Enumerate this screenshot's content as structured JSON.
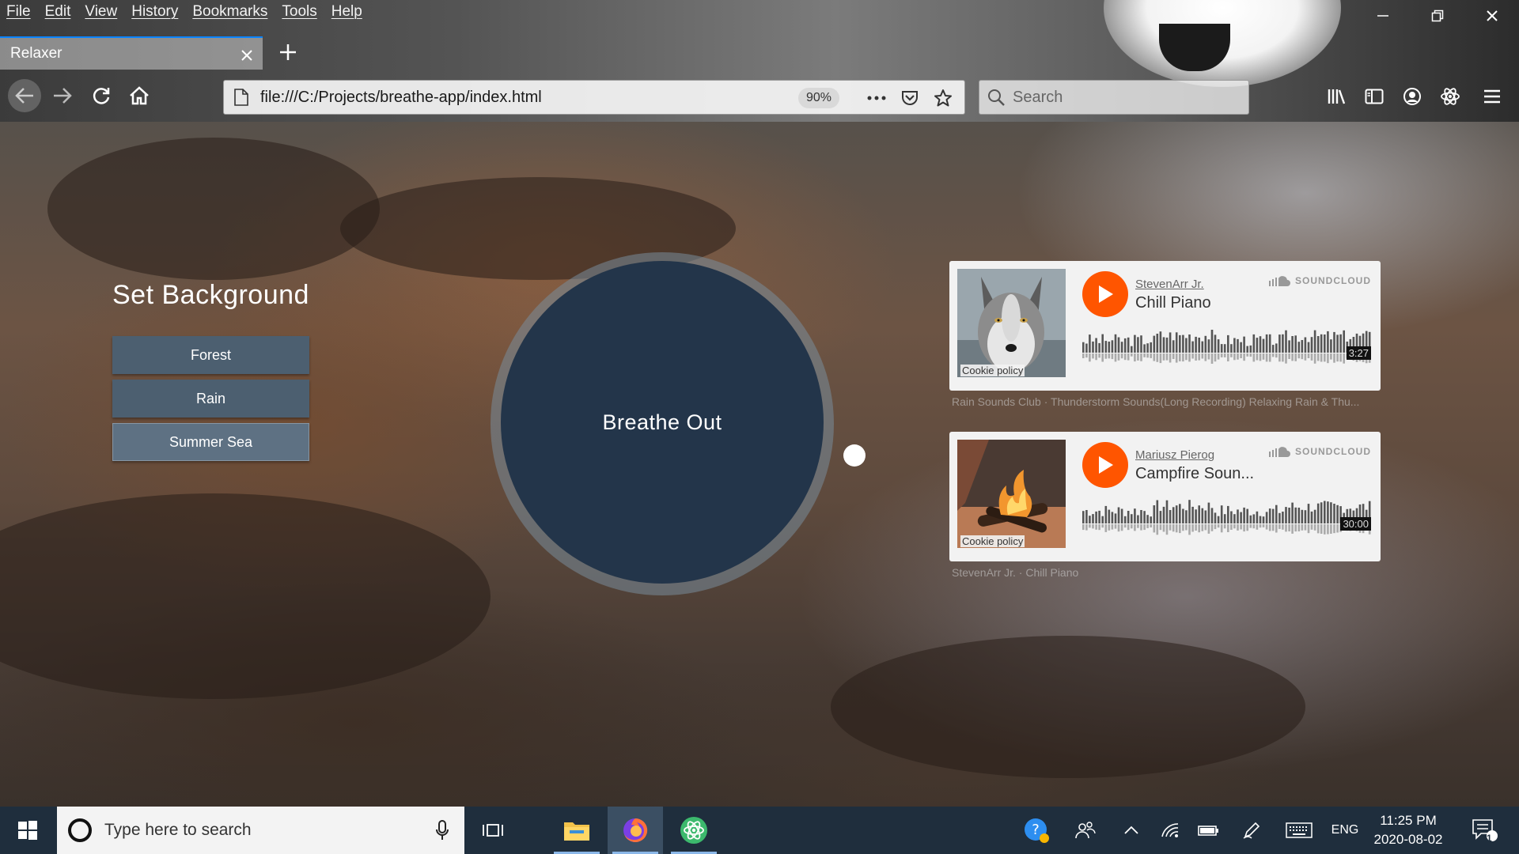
{
  "menu": [
    "File",
    "Edit",
    "View",
    "History",
    "Bookmarks",
    "Tools",
    "Help"
  ],
  "tab": {
    "title": "Relaxer"
  },
  "address": {
    "url": "file:///C:/Projects/breathe-app/index.html",
    "zoom": "90%"
  },
  "search": {
    "placeholder": "Search"
  },
  "sidebar": {
    "title": "Set Background",
    "buttons": [
      "Forest",
      "Rain",
      "Summer Sea"
    ],
    "selected": "Summer Sea"
  },
  "breathe": {
    "text": "Breathe Out"
  },
  "players": [
    {
      "user": "StevenArr Jr.",
      "track": "Chill Piano",
      "duration": "3:27",
      "brand": "SOUNDCLOUD",
      "cookie": "Cookie policy",
      "art": "wolf-artwork"
    },
    {
      "user": "Mariusz Pierog",
      "track": "Campfire Soun...",
      "duration": "30:00",
      "brand": "SOUNDCLOUD",
      "cookie": "Cookie policy",
      "art": "campfire-artwork"
    }
  ],
  "captions": [
    "Rain Sounds Club · Thunderstorm Sounds(Long Recording) Relaxing Rain & Thu...",
    "StevenArr Jr. · Chill Piano"
  ],
  "taskbar": {
    "search_placeholder": "Type here to search",
    "language": "ENG",
    "time": "11:25 PM",
    "date": "2020-08-02",
    "notification_count": "1"
  },
  "colors": {
    "accent": "#0a84ff",
    "soundcloud": "#ff5500",
    "button": "#4c5f70",
    "circle": "#23354a"
  }
}
